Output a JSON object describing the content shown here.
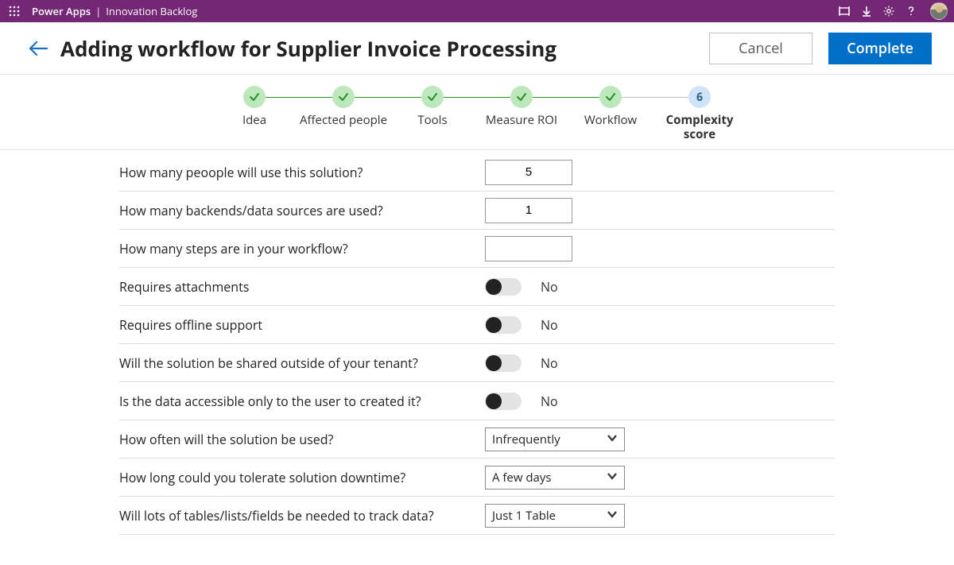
{
  "topbar": {
    "brand": "Power Apps",
    "separator": "|",
    "app_name": "Innovation Backlog"
  },
  "header": {
    "title": "Adding workflow for Supplier Invoice Processing",
    "cancel_label": "Cancel",
    "complete_label": "Complete"
  },
  "stepper": {
    "steps": [
      {
        "label": "Idea"
      },
      {
        "label": "Affected people"
      },
      {
        "label": "Tools"
      },
      {
        "label": "Measure ROI"
      },
      {
        "label": "Workflow"
      },
      {
        "label": "Complexity score",
        "badge": "6"
      }
    ]
  },
  "questions": {
    "q_users": {
      "label": "How many peoople will use this solution?",
      "value": "5"
    },
    "q_backends": {
      "label": "How many backends/data sources are  used?",
      "value": "1"
    },
    "q_steps": {
      "label": "How many steps are in your workflow?",
      "value": ""
    },
    "q_attach": {
      "label": "Requires attachments",
      "value_label": "No"
    },
    "q_offline": {
      "label": "Requires offline support",
      "value_label": "No"
    },
    "q_shared": {
      "label": "Will the solution be shared  outside of your tenant?",
      "value_label": "No"
    },
    "q_private": {
      "label": "Is the data accessible only to the user to created it?",
      "value_label": "No"
    },
    "q_frequency": {
      "label": "How often will the solution be used?",
      "value": "Infrequently"
    },
    "q_downtime": {
      "label": "How long could you tolerate solution downtime?",
      "value": "A few days"
    },
    "q_tables": {
      "label": "Will lots of tables/lists/fields be needed to track data?",
      "value": "Just 1 Table"
    }
  }
}
